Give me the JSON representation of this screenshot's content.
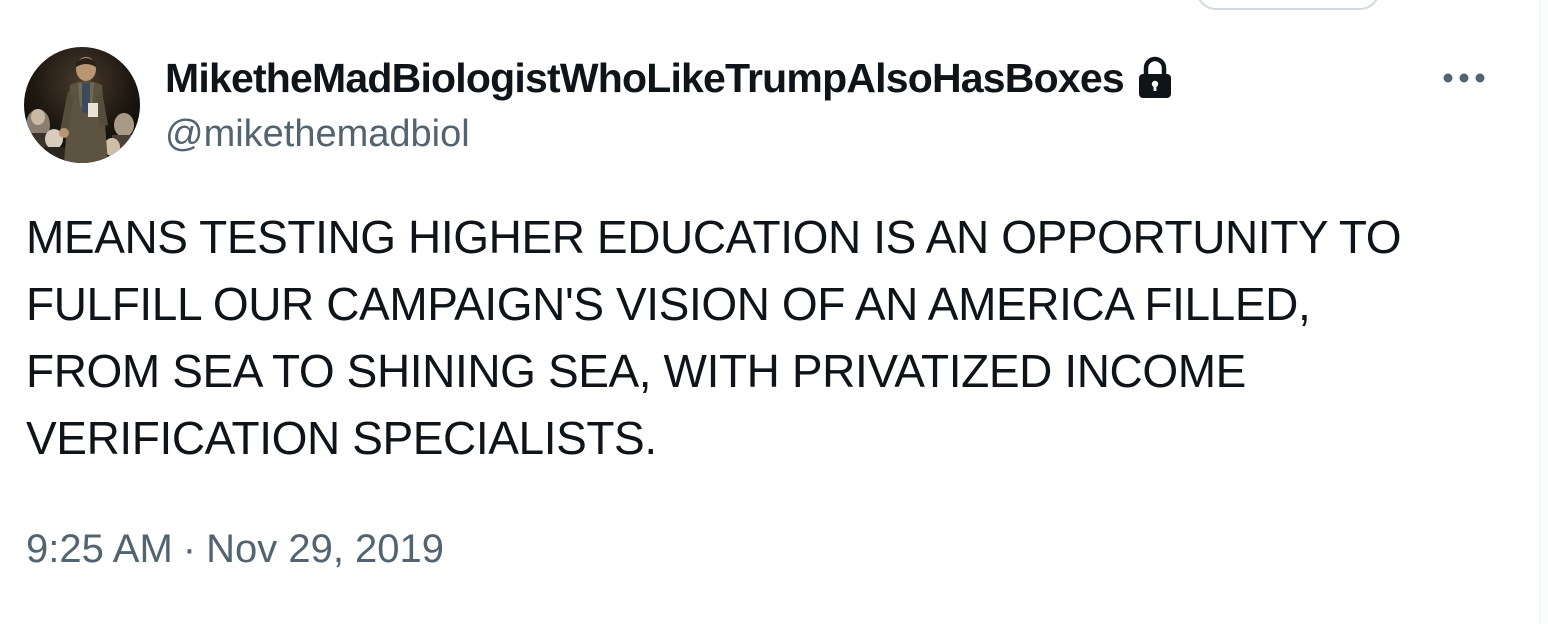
{
  "author": {
    "display_name": "MiketheMadBiologistWhoLikeTrumpAlsoHasBoxes",
    "handle": "@mikethemadbiol",
    "protected_icon": "lock-icon",
    "avatar_icon": "avatar-photo"
  },
  "actions": {
    "more_icon": "more-horizontal-icon"
  },
  "tweet": {
    "text": "MEANS TESTING HIGHER EDUCATION IS AN OPPORTUNITY TO\nFULFILL OUR CAMPAIGN'S VISION OF AN AMERICA FILLED,\nFROM SEA TO SHINING SEA, WITH PRIVATIZED INCOME\nVERIFICATION SPECIALISTS."
  },
  "meta": {
    "time": "9:25 AM",
    "separator": "·",
    "date": "Nov 29, 2019"
  },
  "colors": {
    "text_primary": "#0f1419",
    "text_secondary": "#536471",
    "border": "#cfd9de"
  }
}
